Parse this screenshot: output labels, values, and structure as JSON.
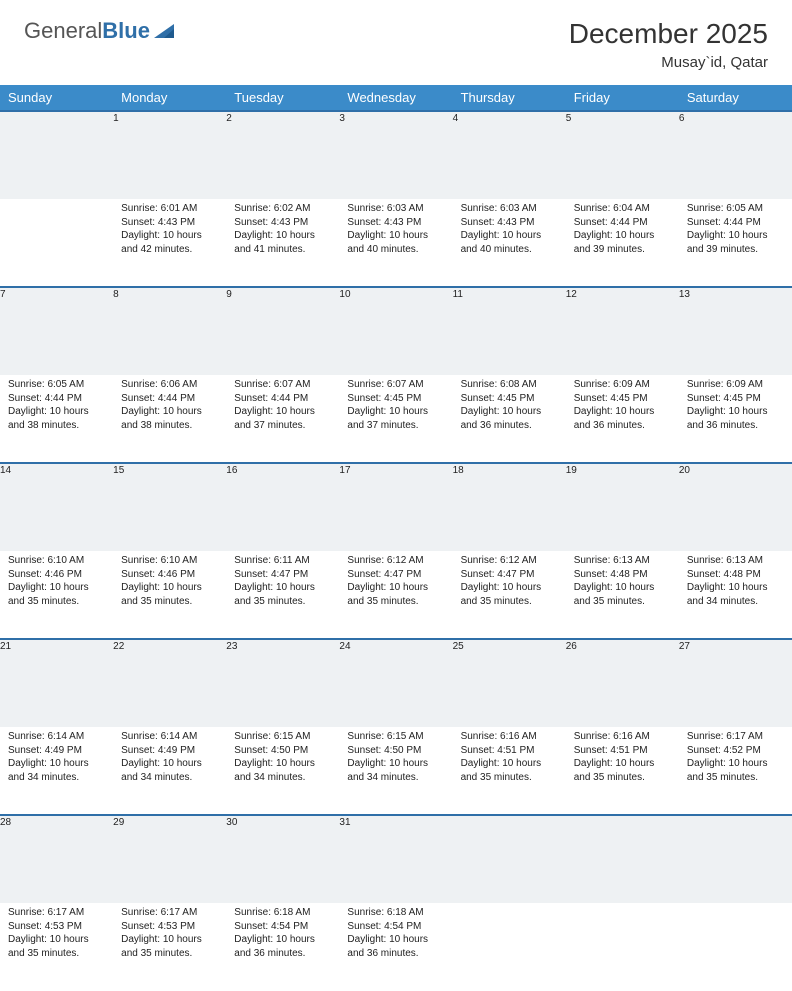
{
  "brand": {
    "part1": "General",
    "part2": "Blue"
  },
  "title": "December 2025",
  "location": "Musay`id, Qatar",
  "weekdays": [
    "Sunday",
    "Monday",
    "Tuesday",
    "Wednesday",
    "Thursday",
    "Friday",
    "Saturday"
  ],
  "weeks": [
    {
      "nums": [
        "",
        "1",
        "2",
        "3",
        "4",
        "5",
        "6"
      ],
      "cells": [
        null,
        {
          "sr": "Sunrise: 6:01 AM",
          "ss": "Sunset: 4:43 PM",
          "d1": "Daylight: 10 hours",
          "d2": "and 42 minutes."
        },
        {
          "sr": "Sunrise: 6:02 AM",
          "ss": "Sunset: 4:43 PM",
          "d1": "Daylight: 10 hours",
          "d2": "and 41 minutes."
        },
        {
          "sr": "Sunrise: 6:03 AM",
          "ss": "Sunset: 4:43 PM",
          "d1": "Daylight: 10 hours",
          "d2": "and 40 minutes."
        },
        {
          "sr": "Sunrise: 6:03 AM",
          "ss": "Sunset: 4:43 PM",
          "d1": "Daylight: 10 hours",
          "d2": "and 40 minutes."
        },
        {
          "sr": "Sunrise: 6:04 AM",
          "ss": "Sunset: 4:44 PM",
          "d1": "Daylight: 10 hours",
          "d2": "and 39 minutes."
        },
        {
          "sr": "Sunrise: 6:05 AM",
          "ss": "Sunset: 4:44 PM",
          "d1": "Daylight: 10 hours",
          "d2": "and 39 minutes."
        }
      ]
    },
    {
      "nums": [
        "7",
        "8",
        "9",
        "10",
        "11",
        "12",
        "13"
      ],
      "cells": [
        {
          "sr": "Sunrise: 6:05 AM",
          "ss": "Sunset: 4:44 PM",
          "d1": "Daylight: 10 hours",
          "d2": "and 38 minutes."
        },
        {
          "sr": "Sunrise: 6:06 AM",
          "ss": "Sunset: 4:44 PM",
          "d1": "Daylight: 10 hours",
          "d2": "and 38 minutes."
        },
        {
          "sr": "Sunrise: 6:07 AM",
          "ss": "Sunset: 4:44 PM",
          "d1": "Daylight: 10 hours",
          "d2": "and 37 minutes."
        },
        {
          "sr": "Sunrise: 6:07 AM",
          "ss": "Sunset: 4:45 PM",
          "d1": "Daylight: 10 hours",
          "d2": "and 37 minutes."
        },
        {
          "sr": "Sunrise: 6:08 AM",
          "ss": "Sunset: 4:45 PM",
          "d1": "Daylight: 10 hours",
          "d2": "and 36 minutes."
        },
        {
          "sr": "Sunrise: 6:09 AM",
          "ss": "Sunset: 4:45 PM",
          "d1": "Daylight: 10 hours",
          "d2": "and 36 minutes."
        },
        {
          "sr": "Sunrise: 6:09 AM",
          "ss": "Sunset: 4:45 PM",
          "d1": "Daylight: 10 hours",
          "d2": "and 36 minutes."
        }
      ]
    },
    {
      "nums": [
        "14",
        "15",
        "16",
        "17",
        "18",
        "19",
        "20"
      ],
      "cells": [
        {
          "sr": "Sunrise: 6:10 AM",
          "ss": "Sunset: 4:46 PM",
          "d1": "Daylight: 10 hours",
          "d2": "and 35 minutes."
        },
        {
          "sr": "Sunrise: 6:10 AM",
          "ss": "Sunset: 4:46 PM",
          "d1": "Daylight: 10 hours",
          "d2": "and 35 minutes."
        },
        {
          "sr": "Sunrise: 6:11 AM",
          "ss": "Sunset: 4:47 PM",
          "d1": "Daylight: 10 hours",
          "d2": "and 35 minutes."
        },
        {
          "sr": "Sunrise: 6:12 AM",
          "ss": "Sunset: 4:47 PM",
          "d1": "Daylight: 10 hours",
          "d2": "and 35 minutes."
        },
        {
          "sr": "Sunrise: 6:12 AM",
          "ss": "Sunset: 4:47 PM",
          "d1": "Daylight: 10 hours",
          "d2": "and 35 minutes."
        },
        {
          "sr": "Sunrise: 6:13 AM",
          "ss": "Sunset: 4:48 PM",
          "d1": "Daylight: 10 hours",
          "d2": "and 35 minutes."
        },
        {
          "sr": "Sunrise: 6:13 AM",
          "ss": "Sunset: 4:48 PM",
          "d1": "Daylight: 10 hours",
          "d2": "and 34 minutes."
        }
      ]
    },
    {
      "nums": [
        "21",
        "22",
        "23",
        "24",
        "25",
        "26",
        "27"
      ],
      "cells": [
        {
          "sr": "Sunrise: 6:14 AM",
          "ss": "Sunset: 4:49 PM",
          "d1": "Daylight: 10 hours",
          "d2": "and 34 minutes."
        },
        {
          "sr": "Sunrise: 6:14 AM",
          "ss": "Sunset: 4:49 PM",
          "d1": "Daylight: 10 hours",
          "d2": "and 34 minutes."
        },
        {
          "sr": "Sunrise: 6:15 AM",
          "ss": "Sunset: 4:50 PM",
          "d1": "Daylight: 10 hours",
          "d2": "and 34 minutes."
        },
        {
          "sr": "Sunrise: 6:15 AM",
          "ss": "Sunset: 4:50 PM",
          "d1": "Daylight: 10 hours",
          "d2": "and 34 minutes."
        },
        {
          "sr": "Sunrise: 6:16 AM",
          "ss": "Sunset: 4:51 PM",
          "d1": "Daylight: 10 hours",
          "d2": "and 35 minutes."
        },
        {
          "sr": "Sunrise: 6:16 AM",
          "ss": "Sunset: 4:51 PM",
          "d1": "Daylight: 10 hours",
          "d2": "and 35 minutes."
        },
        {
          "sr": "Sunrise: 6:17 AM",
          "ss": "Sunset: 4:52 PM",
          "d1": "Daylight: 10 hours",
          "d2": "and 35 minutes."
        }
      ]
    },
    {
      "nums": [
        "28",
        "29",
        "30",
        "31",
        "",
        "",
        ""
      ],
      "cells": [
        {
          "sr": "Sunrise: 6:17 AM",
          "ss": "Sunset: 4:53 PM",
          "d1": "Daylight: 10 hours",
          "d2": "and 35 minutes."
        },
        {
          "sr": "Sunrise: 6:17 AM",
          "ss": "Sunset: 4:53 PM",
          "d1": "Daylight: 10 hours",
          "d2": "and 35 minutes."
        },
        {
          "sr": "Sunrise: 6:18 AM",
          "ss": "Sunset: 4:54 PM",
          "d1": "Daylight: 10 hours",
          "d2": "and 36 minutes."
        },
        {
          "sr": "Sunrise: 6:18 AM",
          "ss": "Sunset: 4:54 PM",
          "d1": "Daylight: 10 hours",
          "d2": "and 36 minutes."
        },
        null,
        null,
        null
      ]
    }
  ]
}
